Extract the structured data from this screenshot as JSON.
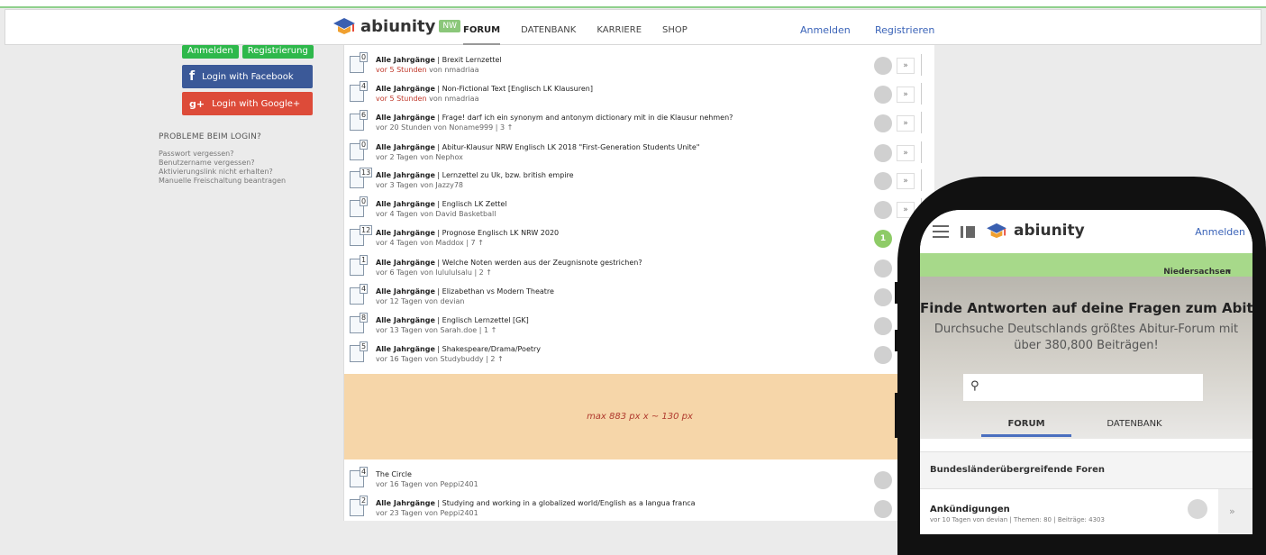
{
  "header": {
    "logo_text": "abiunity",
    "region_badge": "NW",
    "nav": [
      "FORUM",
      "DATENBANK",
      "KARRIERE",
      "SHOP"
    ],
    "login": "Anmelden",
    "register": "Registrieren"
  },
  "sidebar": {
    "top_buttons": [
      "Anmelden",
      "Registrierung"
    ],
    "facebook": "Login with Facebook",
    "google": "Login with Google+",
    "problems_title": "PROBLEME BEIM LOGIN?",
    "problem_links": [
      "Passwort vergessen?",
      "Benutzername vergessen?",
      "Aktivierungslink nicht erhalten?",
      "Manuelle Freischaltung beantragen"
    ]
  },
  "topics": [
    {
      "count": "0",
      "category": "Alle Jahrgänge",
      "title": "Brexit Lernzettel",
      "time": "vor 5 Stunden",
      "meta": "von nmadriaa",
      "time_red": true
    },
    {
      "count": "4",
      "category": "Alle Jahrgänge",
      "title": "Non-Fictional Text [Englisch LK Klausuren]",
      "time": "vor 5 Stunden",
      "meta": "von nmadriaa",
      "time_red": true
    },
    {
      "count": "6",
      "category": "Alle Jahrgänge",
      "title": "Frage! darf ich ein synonym and antonym dictionary mit in die Klausur nehmen?",
      "time": "vor 20 Stunden",
      "meta": "von Noname999 | 3 ↑",
      "time_red": false
    },
    {
      "count": "0",
      "category": "Alle Jahrgänge",
      "title": "Abitur-Klausur NRW Englisch LK 2018 \"First-Generation Students Unite\"",
      "time": "vor 2 Tagen",
      "meta": "von Nephox",
      "time_red": false
    },
    {
      "count": "13",
      "category": "Alle Jahrgänge",
      "title": "Lernzettel zu Uk, bzw. british empire",
      "time": "vor 3 Tagen",
      "meta": "von Jazzy78",
      "time_red": false
    },
    {
      "count": "0",
      "category": "Alle Jahrgänge",
      "title": "Englisch LK Zettel",
      "time": "vor 4 Tagen",
      "meta": "von David Basketball",
      "time_red": false
    },
    {
      "count": "12",
      "category": "Alle Jahrgänge",
      "title": "Prognose Englisch LK NRW 2020",
      "time": "vor 4 Tagen",
      "meta": "von Maddox | 7 ↑",
      "time_red": false
    },
    {
      "count": "1",
      "category": "Alle Jahrgänge",
      "title": "Welche Noten werden aus der Zeugnisnote gestrichen?",
      "time": "vor 6 Tagen",
      "meta": "von lulululsalu | 2 ↑",
      "time_red": false
    },
    {
      "count": "4",
      "category": "Alle Jahrgänge",
      "title": "Elizabethan vs Modern Theatre",
      "time": "vor 12 Tagen",
      "meta": "von devian",
      "time_red": false
    },
    {
      "count": "8",
      "category": "Alle Jahrgänge",
      "title": "Englisch Lernzettel [GK]",
      "time": "vor 13 Tagen",
      "meta": "von Sarah.doe | 1 ↑",
      "time_red": false
    },
    {
      "count": "5",
      "category": "Alle Jahrgänge",
      "title": "Shakespeare/Drama/Poetry",
      "time": "vor 16 Tagen",
      "meta": "von Studybuddy | 2 ↑",
      "time_red": false
    },
    {
      "count": "4",
      "category": "",
      "title": "The Circle",
      "time": "vor 16 Tagen",
      "meta": "von Peppi2401",
      "time_red": false
    },
    {
      "count": "2",
      "category": "Alle Jahrgänge",
      "title": "Studying and working in a globalized world/English as a langua franca",
      "time": "vor 23 Tagen",
      "meta": "von Peppi2401",
      "time_red": false
    }
  ],
  "avatar_badge": "1",
  "arrow_glyph": "»",
  "ad_text": "max 883 px x  ~ 130 px",
  "mobile": {
    "logo_text": "abiunity",
    "login": "Anmelden",
    "region": "Niedersachsen",
    "hero_title": "Finde Antworten auf deine Fragen zum Abitur:",
    "hero_subtitle": "Durchsuche Deutschlands größtes Abitur-Forum mit über 380,800 Beiträgen!",
    "tabs": [
      "FORUM",
      "DATENBANK"
    ],
    "section": "Bundesländerübergreifende Foren",
    "item_title": "Ankündigungen",
    "item_meta": "vor 10 Tagen von devian  |  Themen: 80  |  Beiträge: 4303"
  },
  "colors": {
    "accent_green": "#2eb84b",
    "facebook": "#3b5998",
    "google": "#dd4b39",
    "link_blue": "#3a63b8",
    "ad_bg": "#f6d6a9"
  }
}
